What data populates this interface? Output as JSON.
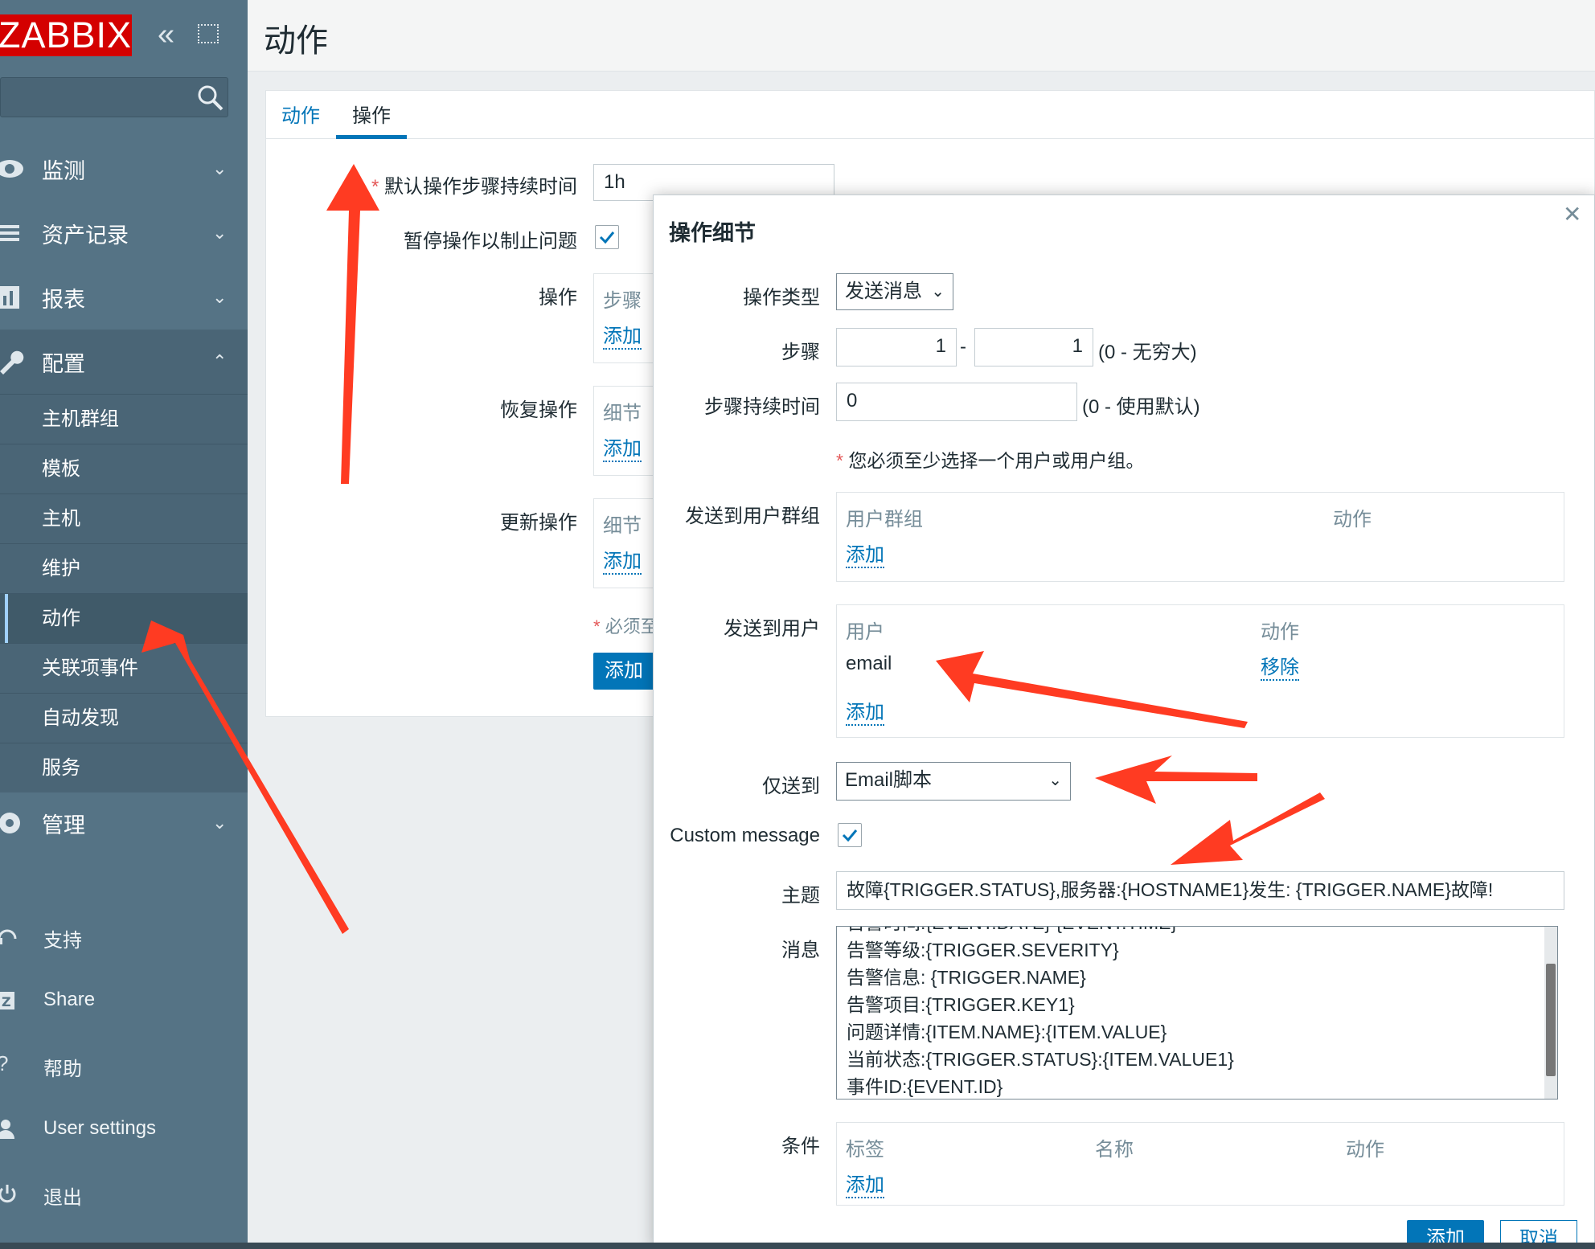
{
  "brand": {
    "logo": "ZABBIX"
  },
  "sidebar": {
    "menu": [
      {
        "label": "监测",
        "icon": "eye-icon"
      },
      {
        "label": "资产记录",
        "icon": "list-icon"
      },
      {
        "label": "报表",
        "icon": "bar-chart-icon"
      },
      {
        "label": "配置",
        "icon": "wrench-icon"
      },
      {
        "label": "管理",
        "icon": "gear-icon"
      }
    ],
    "config_items": [
      "主机群组",
      "模板",
      "主机",
      "维护",
      "动作",
      "关联项事件",
      "自动发现",
      "服务"
    ],
    "active_item": "动作",
    "bottom": [
      {
        "label": "支持",
        "icon": "headset-icon"
      },
      {
        "label": "Share",
        "icon": "share-icon"
      },
      {
        "label": "帮助",
        "icon": "help-icon"
      },
      {
        "label": "User settings",
        "icon": "user-icon"
      },
      {
        "label": "退出",
        "icon": "power-icon"
      }
    ]
  },
  "page": {
    "title": "动作",
    "tabs": [
      "动作",
      "操作"
    ],
    "form": {
      "default_step_duration_label": "默认操作步骤持续时间",
      "default_step_duration_value": "1h",
      "pause_label": "暂停操作以制止问题",
      "operations_label": "操作",
      "operations_col": "步骤",
      "recovery_label": "恢复操作",
      "recovery_col": "细节",
      "update_label": "更新操作",
      "update_col": "细节",
      "add_link": "添加",
      "required_note": "必须至",
      "add_button": "添加"
    }
  },
  "modal": {
    "title": "操作细节",
    "op_type_label": "操作类型",
    "op_type_value": "发送消息",
    "steps_label": "步骤",
    "step_from": "1",
    "step_to": "1",
    "steps_hint": "(0 - 无穷大)",
    "step_duration_label": "步骤持续时间",
    "step_duration_value": "0",
    "step_duration_hint": "(0 - 使用默认)",
    "warning": "您必须至少选择一个用户或用户组。",
    "send_groups_label": "发送到用户群组",
    "groups_col_name": "用户群组",
    "groups_col_action": "动作",
    "add_link": "添加",
    "send_users_label": "发送到用户",
    "users_col_name": "用户",
    "users_col_action": "动作",
    "user_row_name": "email",
    "user_row_remove": "移除",
    "send_only_label": "仅送到",
    "send_only_value": "Email脚本",
    "custom_message_label": "Custom message",
    "subject_label": "主题",
    "subject_value": "故障{TRIGGER.STATUS},服务器:{HOSTNAME1}发生: {TRIGGER.NAME}故障!",
    "message_label": "消息",
    "message_lines": [
      "告警时间:{EVENT.DATE} {EVENT.TIME}",
      "告警等级:{TRIGGER.SEVERITY}",
      "告警信息: {TRIGGER.NAME}",
      "告警项目:{TRIGGER.KEY1}",
      "问题详情:{ITEM.NAME}:{ITEM.VALUE}",
      "当前状态:{TRIGGER.STATUS}:{ITEM.VALUE1}",
      "事件ID:{EVENT.ID}"
    ],
    "conditions_label": "条件",
    "cond_col_tag": "标签",
    "cond_col_name": "名称",
    "cond_col_action": "动作",
    "btn_add": "添加",
    "btn_cancel": "取消"
  },
  "colors": {
    "sidebar": "#557385",
    "accent": "#0275b8",
    "logo": "#d40000",
    "annotation": "#ff3b22"
  }
}
